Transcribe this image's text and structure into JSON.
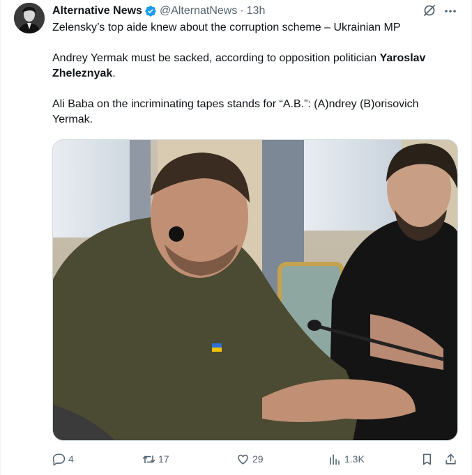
{
  "tweet": {
    "author_name": "Alternative News",
    "handle": "@AlternatNews",
    "separator": "·",
    "time": "13h",
    "lines": [
      "Zelensky’s top aide knew about the corruption scheme – Ukrainian MP",
      "Andrey Yermak must be sacked, according to opposition politician",
      "Yaroslav Zheleznyak",
      ".",
      "Ali Baba on the incriminating tapes stands for “A.B.”: (A)ndrey (B)orisovich Yermak."
    ]
  },
  "actions": {
    "replies": "4",
    "reposts": "17",
    "likes": "29",
    "views": "1.3K"
  },
  "colors": {
    "verified": "#1d9bf0",
    "secondary_text": "#536471",
    "primary_text": "#0f1419"
  },
  "icons": [
    "avatar",
    "verified-badge-icon",
    "grok-icon",
    "more-icon",
    "reply-icon",
    "repost-icon",
    "like-icon",
    "views-icon",
    "bookmark-icon",
    "share-icon"
  ]
}
